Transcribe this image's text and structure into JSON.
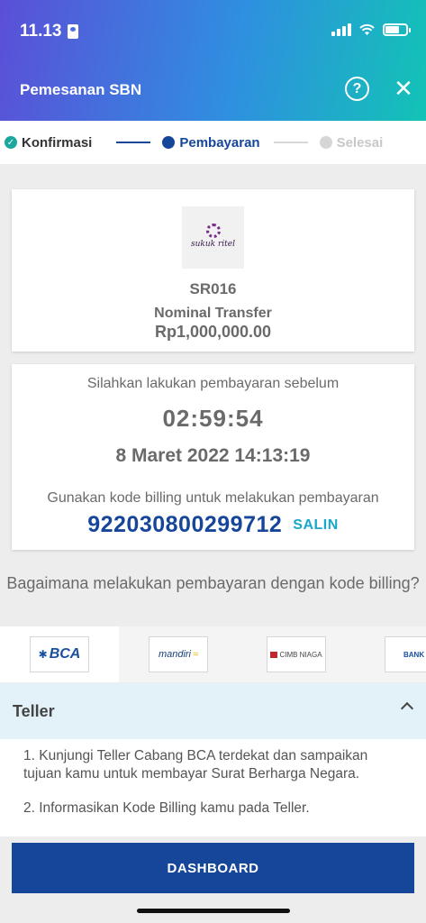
{
  "status_bar": {
    "time": "11.13"
  },
  "header": {
    "title": "Pemesanan SBN",
    "help_label": "?",
    "close_label": "✕"
  },
  "stepper": {
    "steps": [
      {
        "label": "Konfirmasi",
        "state": "done"
      },
      {
        "label": "Pembayaran",
        "state": "active"
      },
      {
        "label": "Selesai",
        "state": "pending"
      }
    ],
    "colors": {
      "done": "#1aa7a0",
      "active": "#16469a",
      "pending": "#cfcfcf"
    }
  },
  "product": {
    "logo_text": "sukuk ritel",
    "series": "SR016",
    "nominal_label": "Nominal Transfer",
    "nominal_value": "Rp1,000,000.00"
  },
  "payment": {
    "pay_before_label": "Silahkan lakukan pembayaran sebelum",
    "countdown": "02:59:54",
    "deadline": "8 Maret 2022 14:13:19",
    "billing_hint": "Gunakan kode billing untuk melakukan pembayaran",
    "billing_code": "922030800299712",
    "copy_label": "SALIN"
  },
  "howto_title": "Bagaimana melakukan pembayaran dengan kode billing?",
  "banks": [
    {
      "name": "BCA",
      "active": true
    },
    {
      "name": "mandiri",
      "active": false
    },
    {
      "name": "CIMB NIAGA",
      "active": false
    },
    {
      "name": "BANK",
      "active": false
    }
  ],
  "accordion": {
    "title": "Teller",
    "steps": [
      "1. Kunjungi Teller Cabang BCA terdekat dan sampaikan tujuan kamu untuk membayar Surat Berharga Negara.",
      "2. Informasikan Kode Billing kamu pada Teller."
    ]
  },
  "footer": {
    "button_label": "DASHBOARD"
  },
  "colors": {
    "primary": "#16469a",
    "accent": "#1aa7c8"
  }
}
